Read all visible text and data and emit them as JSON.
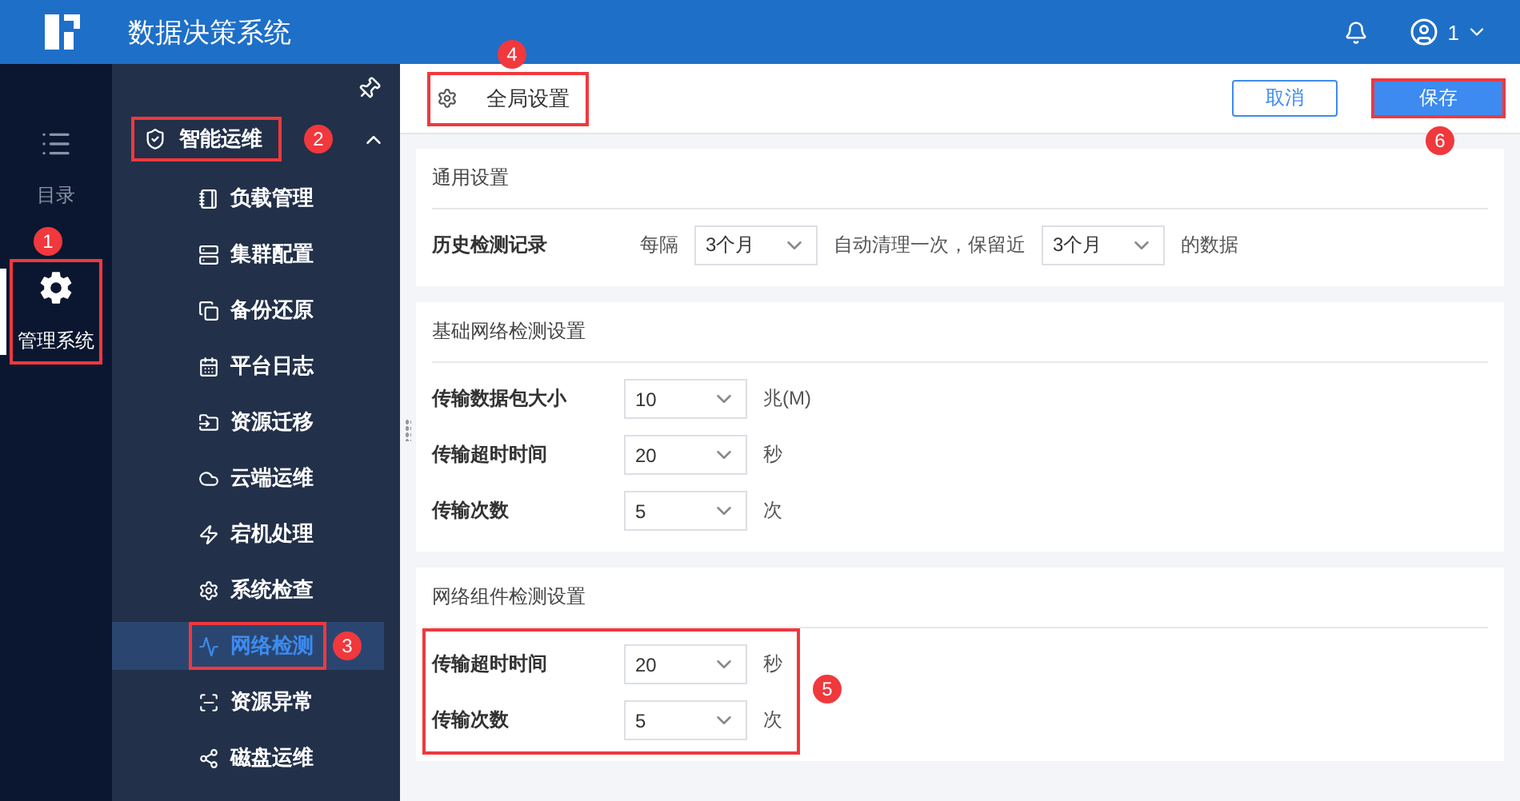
{
  "header": {
    "title": "数据决策系统",
    "user": "1"
  },
  "rail": [
    {
      "label": "目录",
      "selected": false
    },
    {
      "label": "管理系统",
      "selected": true,
      "callout": "1"
    }
  ],
  "sidebar": {
    "group": {
      "label": "智能运维",
      "expanded": true,
      "callout": "2",
      "items": [
        {
          "label": "负载管理",
          "selected": false
        },
        {
          "label": "集群配置",
          "selected": false
        },
        {
          "label": "备份还原",
          "selected": false
        },
        {
          "label": "平台日志",
          "selected": false
        },
        {
          "label": "资源迁移",
          "selected": false
        },
        {
          "label": "云端运维",
          "selected": false
        },
        {
          "label": "宕机处理",
          "selected": false
        },
        {
          "label": "系统检查",
          "selected": false
        },
        {
          "label": "网络检测",
          "selected": true,
          "callout": "3"
        },
        {
          "label": "资源异常",
          "selected": false
        },
        {
          "label": "磁盘运维",
          "selected": false
        }
      ]
    }
  },
  "toolbar": {
    "title": "全局设置",
    "callout": "4",
    "buttons": [
      {
        "label": "取消",
        "kind": "secondary"
      },
      {
        "label": "保存",
        "kind": "primary",
        "callout": "6"
      }
    ]
  },
  "sections": [
    {
      "title": "通用设置",
      "rows": [
        {
          "kind": "inline",
          "label": "历史检测记录",
          "parts": [
            {
              "kind": "text",
              "text": "每隔"
            },
            {
              "kind": "select",
              "value": "3个月"
            },
            {
              "kind": "text",
              "text": "自动清理一次，保留近"
            },
            {
              "kind": "select",
              "value": "3个月"
            },
            {
              "kind": "text",
              "text": "的数据"
            }
          ]
        }
      ]
    },
    {
      "title": "基础网络检测设置",
      "rows": [
        {
          "kind": "select",
          "label": "传输数据包大小",
          "value": "10",
          "unit": "兆(M)"
        },
        {
          "kind": "select",
          "label": "传输超时时间",
          "value": "20",
          "unit": "秒"
        },
        {
          "kind": "select",
          "label": "传输次数",
          "value": "5",
          "unit": "次"
        }
      ]
    },
    {
      "title": "网络组件检测设置",
      "callout": "5",
      "rows": [
        {
          "kind": "select",
          "label": "传输超时时间",
          "value": "20",
          "unit": "秒"
        },
        {
          "kind": "select",
          "label": "传输次数",
          "value": "5",
          "unit": "次"
        }
      ]
    }
  ]
}
